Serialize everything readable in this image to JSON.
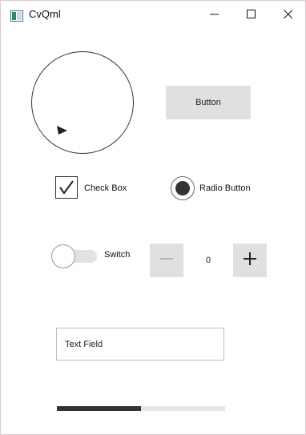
{
  "window": {
    "title": "CvQml",
    "icons": {
      "app": "window-app-icon",
      "minimize": "minimize-icon",
      "maximize": "maximize-icon",
      "close": "close-icon"
    }
  },
  "controls": {
    "dial": {
      "handle_icon": "dial-handle-icon"
    },
    "button": {
      "label": "Button"
    },
    "checkbox": {
      "label": "Check Box",
      "checked": true
    },
    "radio": {
      "label": "Radio Button",
      "checked": true
    },
    "switch": {
      "label": "Switch",
      "on": false
    },
    "spinbox": {
      "value": "0",
      "decrement_icon": "minus-icon",
      "increment_icon": "plus-icon"
    },
    "textfield": {
      "placeholder": "Text Field",
      "value": ""
    },
    "progress": {
      "value": 0.5
    }
  },
  "colors": {
    "control_gray": "#e0e0e0",
    "dark": "#333333",
    "window_border": "#e3c7cf"
  }
}
